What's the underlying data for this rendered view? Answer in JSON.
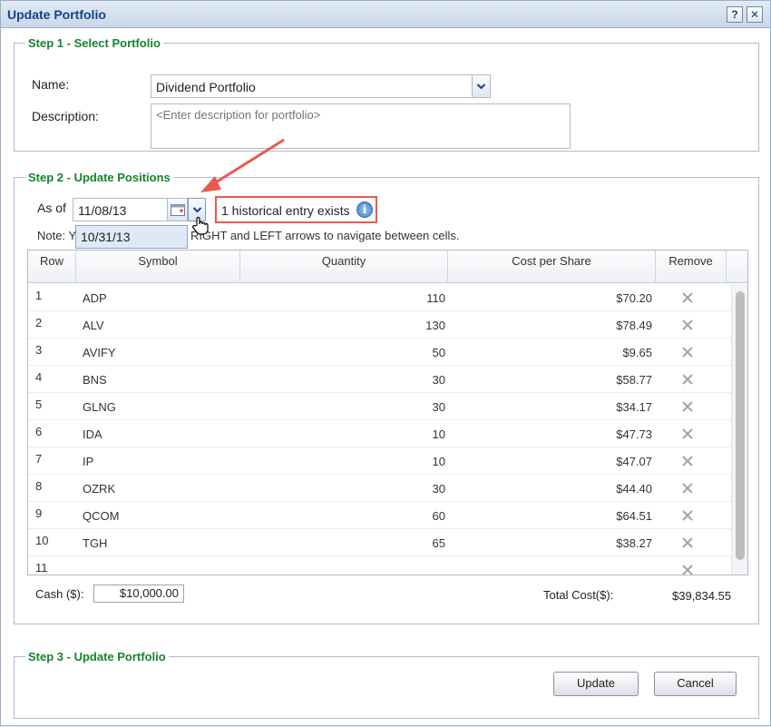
{
  "window": {
    "title": "Update Portfolio",
    "help_label": "?",
    "close_label": "✕"
  },
  "step1": {
    "legend": "Step 1 - Select Portfolio",
    "name_label": "Name:",
    "name_value": "Dividend Portfolio",
    "description_label": "Description:",
    "description_placeholder": "<Enter description for portfolio>"
  },
  "step2": {
    "legend": "Step 2 - Update Positions",
    "as_of_label": "As of",
    "as_of_value": "11/08/13",
    "dropdown_option": "10/31/13",
    "history_text": "1 historical entry exists",
    "note_prefix": "Note: Y",
    "note_suffix": "RIGHT and LEFT arrows to navigate between cells.",
    "columns": {
      "row": "Row",
      "symbol": "Symbol",
      "quantity": "Quantity",
      "cost": "Cost per Share",
      "remove": "Remove"
    },
    "rows": [
      {
        "row": "1",
        "symbol": "ADP",
        "quantity": "110",
        "cost": "$70.20"
      },
      {
        "row": "2",
        "symbol": "ALV",
        "quantity": "130",
        "cost": "$78.49"
      },
      {
        "row": "3",
        "symbol": "AVIFY",
        "quantity": "50",
        "cost": "$9.65"
      },
      {
        "row": "4",
        "symbol": "BNS",
        "quantity": "30",
        "cost": "$58.77"
      },
      {
        "row": "5",
        "symbol": "GLNG",
        "quantity": "30",
        "cost": "$34.17"
      },
      {
        "row": "6",
        "symbol": "IDA",
        "quantity": "10",
        "cost": "$47.73"
      },
      {
        "row": "7",
        "symbol": "IP",
        "quantity": "10",
        "cost": "$47.07"
      },
      {
        "row": "8",
        "symbol": "OZRK",
        "quantity": "30",
        "cost": "$44.40"
      },
      {
        "row": "9",
        "symbol": "QCOM",
        "quantity": "60",
        "cost": "$64.51"
      },
      {
        "row": "10",
        "symbol": "TGH",
        "quantity": "65",
        "cost": "$38.27"
      },
      {
        "row": "11",
        "symbol": "",
        "quantity": "",
        "cost": ""
      }
    ],
    "cash_label": "Cash ($):",
    "cash_value": "$10,000.00",
    "total_label": "Total Cost($):",
    "total_value": "$39,834.55"
  },
  "step3": {
    "legend": "Step 3 - Update Portfolio",
    "update_label": "Update",
    "cancel_label": "Cancel"
  },
  "colors": {
    "legend": "#15832f",
    "title": "#15428b",
    "annotation": "#e85a4f"
  },
  "icons": [
    "calendar-icon",
    "chevron-down-icon",
    "info-icon",
    "remove-x-icon",
    "hand-cursor-icon",
    "annotation-arrow"
  ]
}
